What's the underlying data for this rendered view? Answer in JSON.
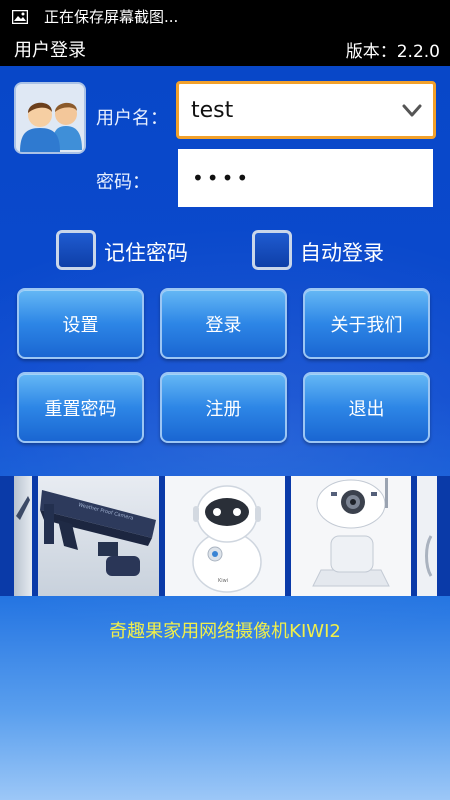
{
  "status_bar": {
    "text": "正在保存屏幕截图...",
    "icon": "image-icon"
  },
  "title_bar": {
    "title": "用户登录",
    "version": "版本：2.2.0"
  },
  "login": {
    "username_label": "用户名：",
    "username_value": "test",
    "password_label": "密码：",
    "password_value": "••••",
    "avatar_icon": "users-icon",
    "dropdown_icon": "chevron-down-icon"
  },
  "options": {
    "remember_password": "记住密码",
    "auto_login": "自动登录"
  },
  "buttons": {
    "settings": "设置",
    "login": "登录",
    "about": "关于我们",
    "reset_password": "重置密码",
    "register": "注册",
    "exit": "退出"
  },
  "gallery": {
    "items": [
      "camera-bullet",
      "camera-robot",
      "camera-ptz"
    ]
  },
  "tagline": "奇趣果家用网络摄像机KIWI2",
  "colors": {
    "accent_border": "#f2a12b",
    "tagline": "#f1ef4a",
    "background": "#0a49cc"
  }
}
